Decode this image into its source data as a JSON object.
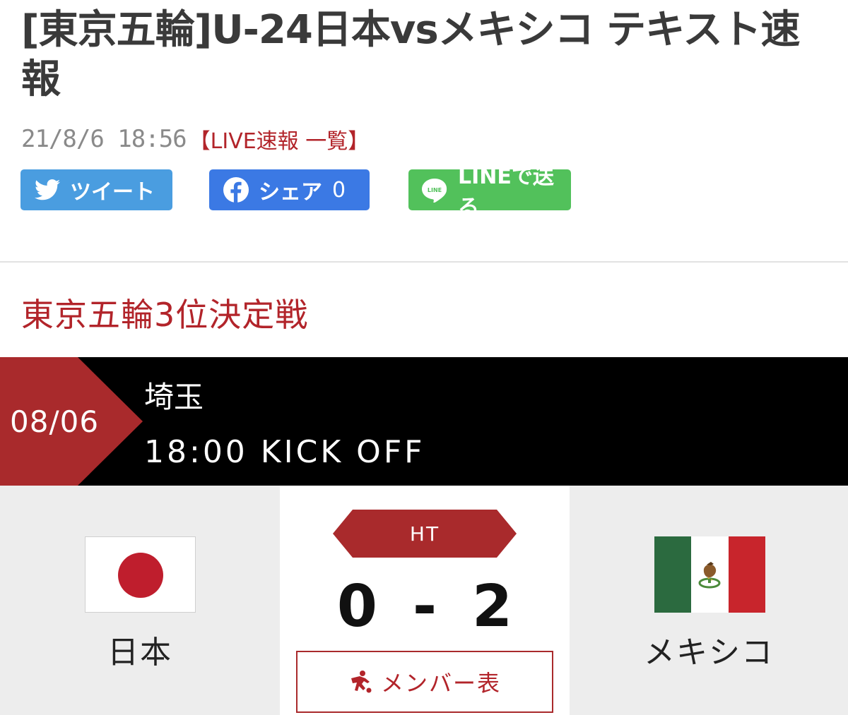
{
  "article": {
    "title": "[東京五輪]U-24日本vsメキシコ テキスト速報",
    "datetime": "21/8/6 18:56",
    "live_link": "【LIVE速報 一覧】"
  },
  "share": {
    "tweet_label": "ツイート",
    "facebook_label": "シェア",
    "facebook_count": "0",
    "line_label": "LINEで送る",
    "line_icon_text": "LINE"
  },
  "match": {
    "heading": "東京五輪3位決定戦",
    "date": "08/06",
    "venue": "埼玉",
    "kickoff": "18:00 KICK OFF",
    "status": "HT",
    "home_team": "日本",
    "away_team": "メキシコ",
    "home_score": "0",
    "score_separator": "-",
    "away_score": "2",
    "members_label": "メンバー表"
  },
  "colors": {
    "accent_red": "#b2242a",
    "twitter_blue": "#4a9de0",
    "facebook_blue": "#3b79e4",
    "line_green": "#52c15b"
  }
}
